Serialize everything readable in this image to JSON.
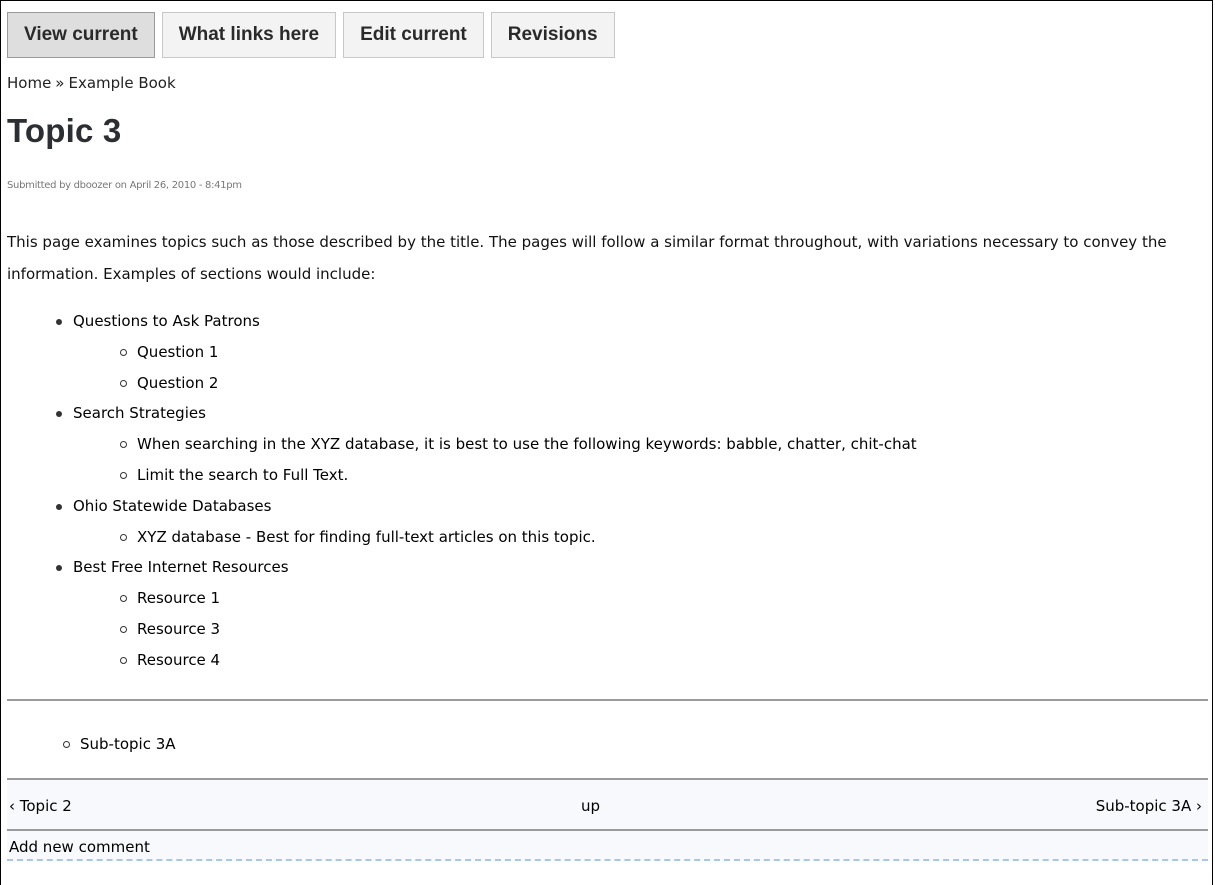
{
  "tabs": [
    {
      "label": "View current",
      "active": true
    },
    {
      "label": "What links here",
      "active": false
    },
    {
      "label": "Edit current",
      "active": false
    },
    {
      "label": "Revisions",
      "active": false
    }
  ],
  "breadcrumb": {
    "home": "Home",
    "separator": "»",
    "book": "Example Book"
  },
  "page": {
    "title": "Topic 3",
    "submitted": "Submitted by dboozer on April 26, 2010 - 8:41pm",
    "intro": "This page examines topics such as those described by the title. The pages will follow a similar format throughout, with variations necessary to convey the information. Examples of sections would include:"
  },
  "sections": [
    {
      "label": "Questions to Ask Patrons",
      "items": [
        "Question 1",
        "Question 2"
      ]
    },
    {
      "label": "Search Strategies",
      "items": [
        "When searching in the XYZ database, it is best to use the following keywords: babble, chatter, chit-chat",
        "Limit the search to Full Text."
      ]
    },
    {
      "label": "Ohio Statewide Databases",
      "items": [
        "XYZ database - Best for finding full-text articles on this topic."
      ]
    },
    {
      "label": "Best Free Internet Resources",
      "items": [
        "Resource 1",
        "Resource 3",
        "Resource 4"
      ]
    }
  ],
  "book_children": [
    "Sub-topic 3A"
  ],
  "book_nav": {
    "prev": "‹ Topic 2",
    "up": "up",
    "next": "Sub-topic 3A ›"
  },
  "comments": {
    "add_new": "Add new comment"
  },
  "colors": {
    "tab_active_bg": "#dedede",
    "tab_bg": "#f3f3f3",
    "title": "#2b2e33",
    "nav_bg": "#f7f9fc",
    "dashed_rule": "#a9c6e6"
  }
}
